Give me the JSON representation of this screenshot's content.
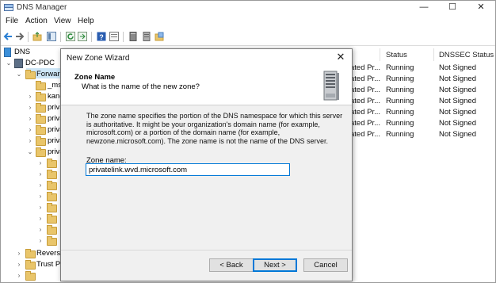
{
  "window": {
    "title": "DNS Manager",
    "controls": {
      "minimize": "—",
      "maximize": "☐",
      "close": "✕"
    }
  },
  "menu": {
    "file": "File",
    "action": "Action",
    "view": "View",
    "help": "Help"
  },
  "tree": {
    "root": "DNS",
    "server": "DC-PDC",
    "forward": "Forward",
    "items": [
      "_ms",
      "kanc",
      "priva",
      "priva",
      "priva",
      "priva",
      "priva"
    ],
    "reverse": "Reverse",
    "trust": "Trust Po"
  },
  "list": {
    "headers": {
      "status": "Status",
      "dnssec": "DNSSEC Status"
    },
    "rows": [
      {
        "type": "ated Pr...",
        "status": "Running",
        "dnssec": "Not Signed"
      },
      {
        "type": "ated Pr...",
        "status": "Running",
        "dnssec": "Not Signed"
      },
      {
        "type": "ated Pr...",
        "status": "Running",
        "dnssec": "Not Signed"
      },
      {
        "type": "ated Pr...",
        "status": "Running",
        "dnssec": "Not Signed"
      },
      {
        "type": "ated Pr...",
        "status": "Running",
        "dnssec": "Not Signed"
      },
      {
        "type": "ated Pr...",
        "status": "Running",
        "dnssec": "Not Signed"
      },
      {
        "type": "ated Pr...",
        "status": "Running",
        "dnssec": "Not Signed"
      }
    ]
  },
  "dialog": {
    "title": "New Zone Wizard",
    "close": "✕",
    "header_title": "Zone Name",
    "header_subtitle": "What is the name of the new zone?",
    "description": "The zone name specifies the portion of the DNS namespace for which this server is authoritative. It might be your organization's domain name (for example,  microsoft.com) or a portion of the domain name (for example, newzone.microsoft.com). The zone name is not the name of the DNS server.",
    "zone_label": "Zone name:",
    "zone_value": "privatelink.wvd.microsoft.com",
    "back": "< Back",
    "next": "Next >",
    "cancel": "Cancel"
  }
}
